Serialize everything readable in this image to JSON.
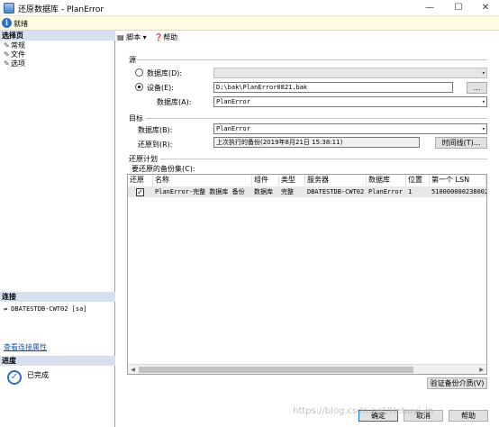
{
  "window": {
    "title": "还原数据库 - PlanError",
    "minimize": "—",
    "maximize": "☐",
    "close": "✕"
  },
  "status": {
    "icon": "info-icon",
    "text": "就绪"
  },
  "left": {
    "select_page_header": "选择页",
    "pages": [
      "常规",
      "文件",
      "选项"
    ],
    "connection_header": "连接",
    "connection_server": "DBATESTDB-CWT02 [sa]",
    "view_connection_link": "查看连接属性",
    "progress_header": "进度",
    "progress_text": "已完成"
  },
  "toolbar": {
    "script_label": "脚本",
    "help_label": "帮助"
  },
  "source": {
    "section": "源",
    "database_radio": "数据库(D):",
    "device_radio": "设备(E):",
    "device_path": "D:\\bak\\PlanError0821.bak",
    "browse": "...",
    "database_label": "数据库(A):",
    "database_value": "PlanError"
  },
  "target": {
    "section": "目标",
    "database_label": "数据库(B):",
    "database_value": "PlanError",
    "restore_to_label": "还原到(R):",
    "restore_to_value": "上次执行的备份(2019年8月21日 15:38:11)",
    "timeline_button": "时间线(T)..."
  },
  "plan": {
    "section": "还原计划",
    "backup_sets_label": "要还原的备份集(C):",
    "columns": [
      "还原",
      "名称",
      "组件",
      "类型",
      "服务器",
      "数据库",
      "位置",
      "第一个 LSN"
    ],
    "rows": [
      [
        "",
        "PlanError-完整 数据库 备份",
        "数据库",
        "完整",
        "DBATESTDB-CWT02",
        "PlanError",
        "1",
        "51000000023800240"
      ]
    ],
    "verify_button": "验证备份介质(V)"
  },
  "footer": {
    "ok": "确定",
    "cancel": "取消",
    "help": "帮助"
  },
  "watermark": "https://blog.csdn.net/Hehuyi_In"
}
